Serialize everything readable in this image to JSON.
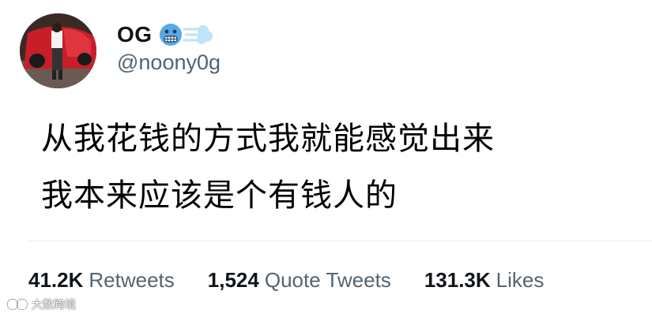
{
  "tweet": {
    "author": {
      "display_name": "OG",
      "handle": "@noony0g",
      "avatar": "profile-photo",
      "name_emojis": [
        "cold-face-emoji",
        "dash-emoji"
      ]
    },
    "text_lines": [
      "从我花钱的方式我就能感觉出来",
      "我本来应该是个有钱人的"
    ],
    "stats": {
      "retweets_count": "41.2K",
      "retweets_label": "Retweets",
      "quote_tweets_count": "1,524",
      "quote_tweets_label": "Quote Tweets",
      "likes_count": "131.3K",
      "likes_label": "Likes"
    }
  },
  "watermark": {
    "text": "大数跨境",
    "icon": "watermark-logo-icon"
  },
  "colors": {
    "text_primary": "#0f1419",
    "text_secondary": "#536471",
    "divider": "#e6ecf0",
    "emoji_blue": "#5aa9e6"
  }
}
